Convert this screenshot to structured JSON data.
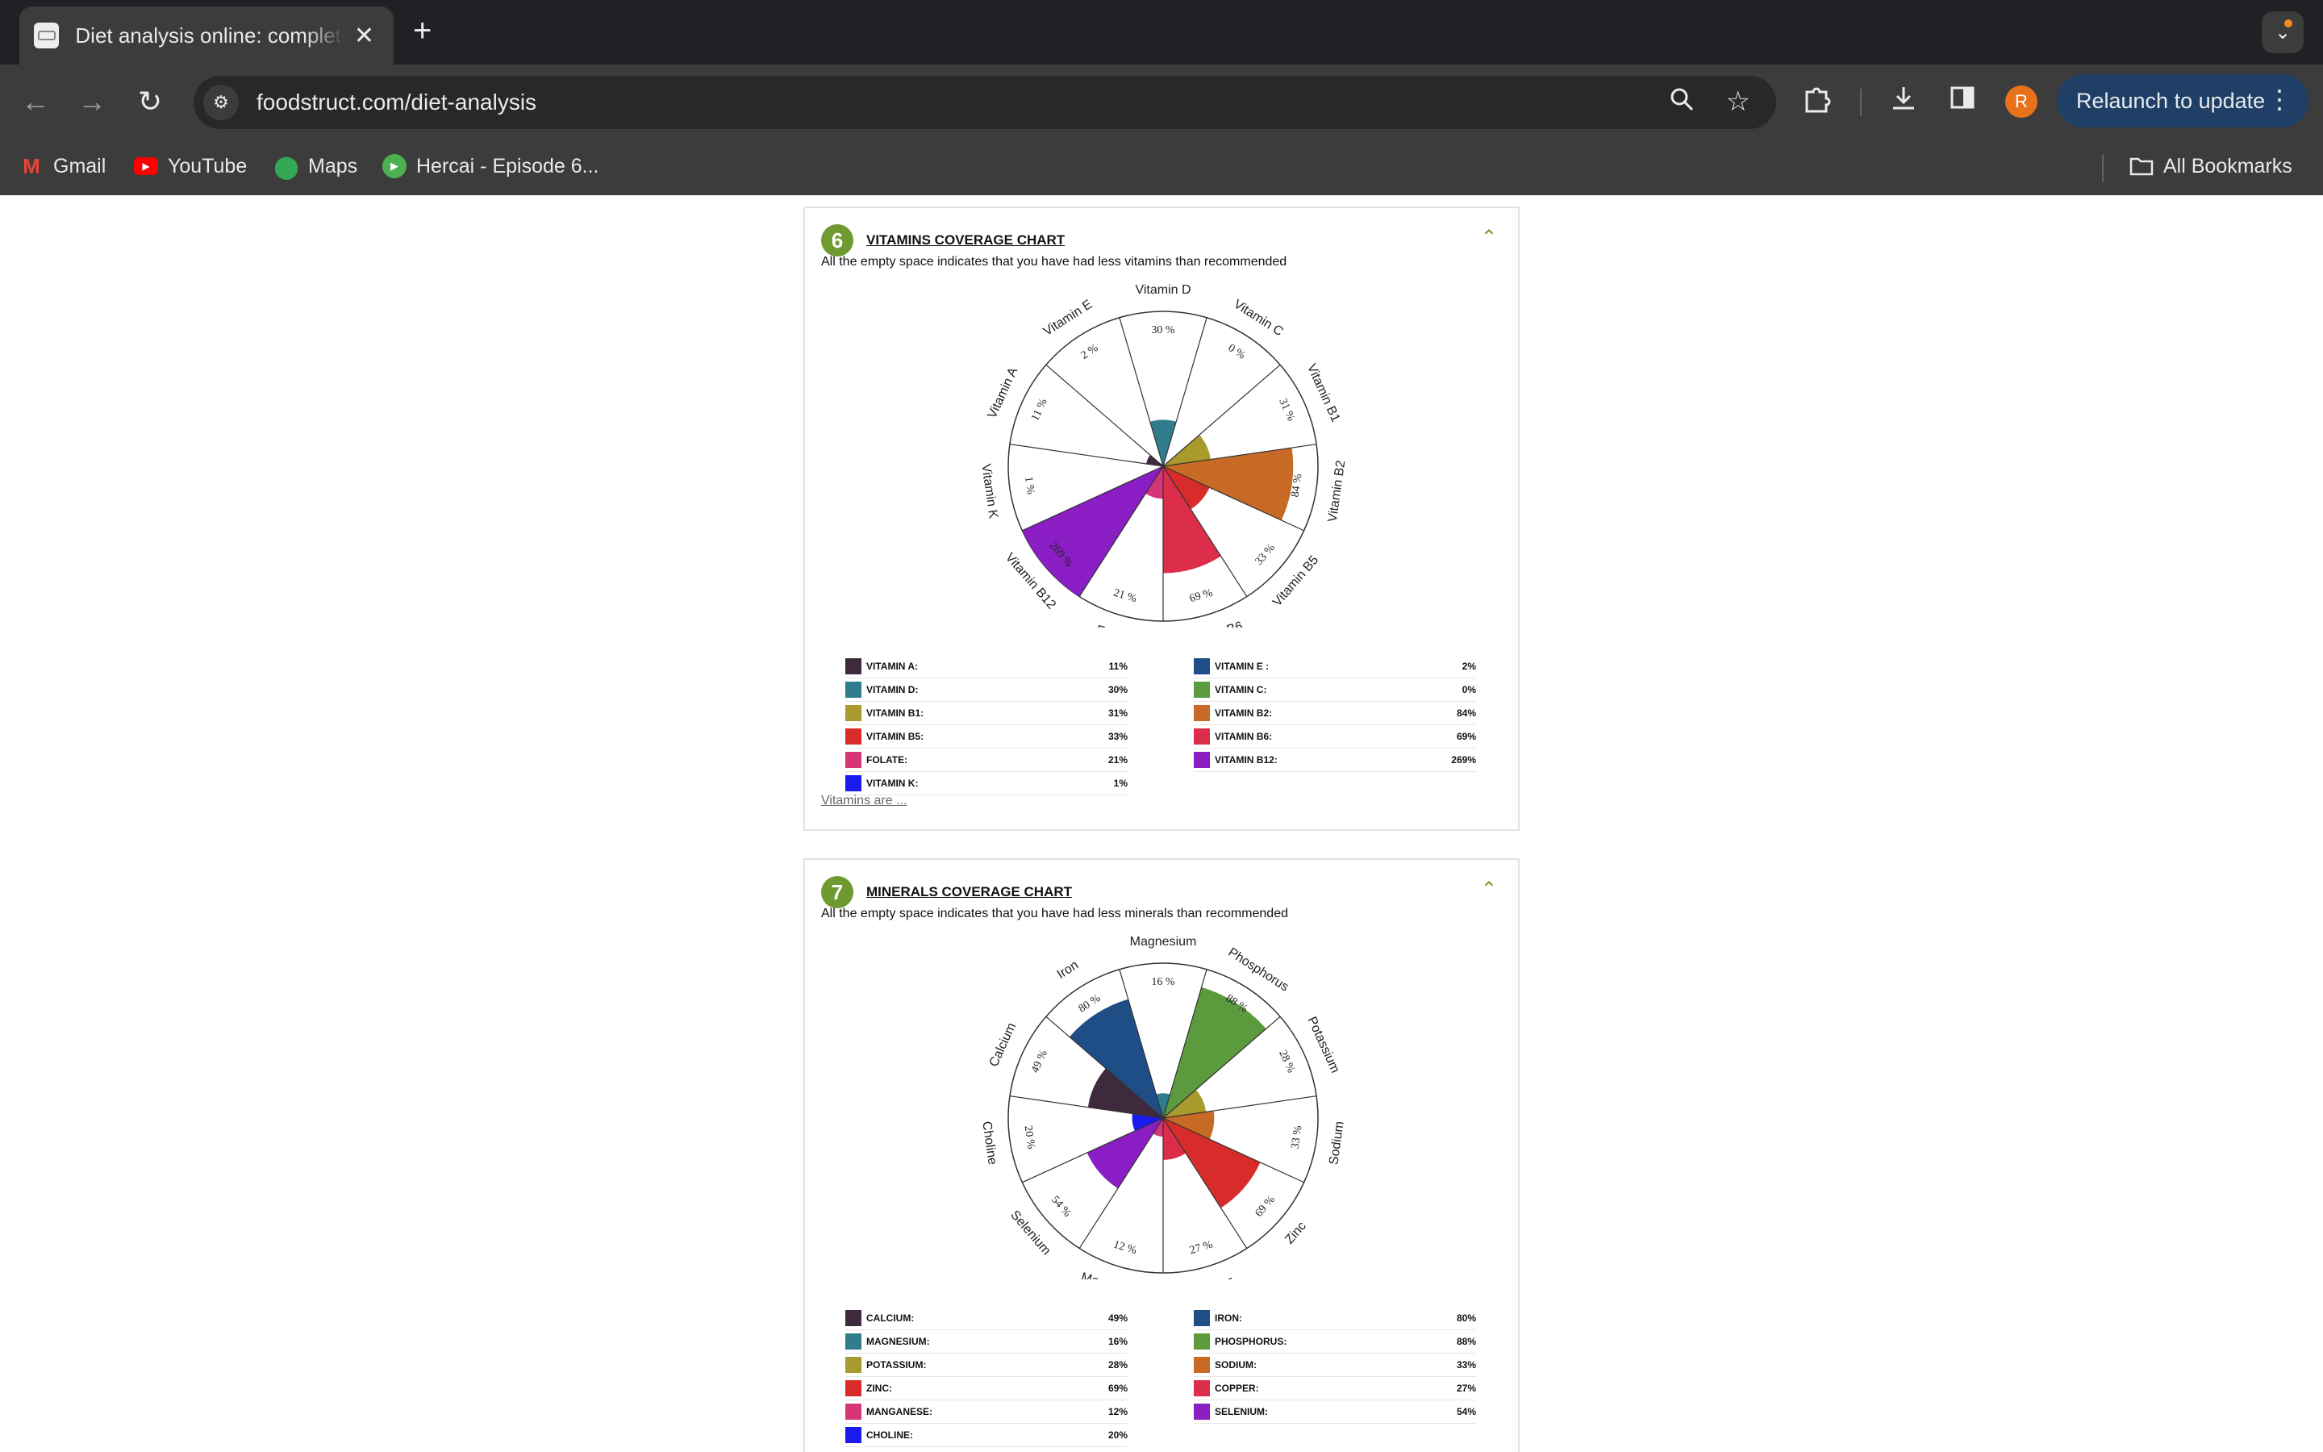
{
  "browser": {
    "tab_title": "Diet analysis online: complete",
    "url": "foodstruct.com/diet-analysis",
    "relaunch_label": "Relaunch to update",
    "avatar_letter": "R",
    "bookmarks": [
      {
        "label": "Gmail",
        "icon": "gmail-icon",
        "color": "#ea4335"
      },
      {
        "label": "YouTube",
        "icon": "youtube-icon",
        "color": "#ff0000"
      },
      {
        "label": "Maps",
        "icon": "maps-icon",
        "color": "#34a853"
      },
      {
        "label": "Hercai - Episode 6...",
        "icon": "play-icon",
        "color": "#4caf50"
      }
    ],
    "all_bookmarks_label": "All Bookmarks"
  },
  "vitamins": {
    "number": "6",
    "title": "VITAMINS COVERAGE CHART",
    "subtitle": "All the empty space indicates that you have had less vitamins than recommended",
    "link": "Vitamins are ...",
    "legend_left": [
      {
        "name": "VITAMIN A:",
        "value": "11%",
        "color": "#3f2a3d"
      },
      {
        "name": "VITAMIN D:",
        "value": "30%",
        "color": "#2f7c8c"
      },
      {
        "name": "VITAMIN B1:",
        "value": "31%",
        "color": "#a89a2c"
      },
      {
        "name": "VITAMIN B5:",
        "value": "33%",
        "color": "#d82c2a"
      },
      {
        "name": "FOLATE:",
        "value": "21%",
        "color": "#d6357a"
      },
      {
        "name": "VITAMIN K:",
        "value": "1%",
        "color": "#1a1aef"
      }
    ],
    "legend_right": [
      {
        "name": "VITAMIN E :",
        "value": "2%",
        "color": "#1f4e86"
      },
      {
        "name": "VITAMIN C:",
        "value": "0%",
        "color": "#5c9a3e"
      },
      {
        "name": "VITAMIN B2:",
        "value": "84%",
        "color": "#c66a25"
      },
      {
        "name": "VITAMIN B6:",
        "value": "69%",
        "color": "#dc2d4b"
      },
      {
        "name": "VITAMIN B12:",
        "value": "269%",
        "color": "#8a1dc4"
      }
    ]
  },
  "minerals": {
    "number": "7",
    "title": "MINERALS COVERAGE CHART",
    "subtitle": "All the empty space indicates that you have had less minerals than recommended",
    "legend_left": [
      {
        "name": "CALCIUM:",
        "value": "49%",
        "color": "#3f2a3d"
      },
      {
        "name": "MAGNESIUM:",
        "value": "16%",
        "color": "#2f7c8c"
      },
      {
        "name": "POTASSIUM:",
        "value": "28%",
        "color": "#a89a2c"
      },
      {
        "name": "ZINC:",
        "value": "69%",
        "color": "#d82c2a"
      },
      {
        "name": "MANGANESE:",
        "value": "12%",
        "color": "#d6357a"
      },
      {
        "name": "CHOLINE:",
        "value": "20%",
        "color": "#1a1aef"
      }
    ],
    "legend_right": [
      {
        "name": "IRON:",
        "value": "80%",
        "color": "#1f4e86"
      },
      {
        "name": "PHOSPHORUS:",
        "value": "88%",
        "color": "#5c9a3e"
      },
      {
        "name": "SODIUM:",
        "value": "33%",
        "color": "#c66a25"
      },
      {
        "name": "COPPER:",
        "value": "27%",
        "color": "#dc2d4b"
      },
      {
        "name": "SELENIUM:",
        "value": "54%",
        "color": "#8a1dc4"
      }
    ]
  },
  "chart_data": [
    {
      "type": "polar-area",
      "title": "VITAMINS COVERAGE CHART",
      "categories": [
        "Vitamin D",
        "Vitamin C",
        "Vitamin B1",
        "Vitamin B2",
        "Vitamin B5",
        "Vitamin B6",
        "Folate",
        "Vitamin B12",
        "Vitamin K",
        "Vitamin A",
        "Vitamin E"
      ],
      "values": [
        30,
        0,
        31,
        84,
        33,
        69,
        21,
        269,
        1,
        11,
        2
      ],
      "colors": [
        "#2f7c8c",
        "#5c9a3e",
        "#a89a2c",
        "#c66a25",
        "#d82c2a",
        "#dc2d4b",
        "#d6357a",
        "#8a1dc4",
        "#1a1aef",
        "#3f2a3d",
        "#1f4e86"
      ],
      "max": 100
    },
    {
      "type": "polar-area",
      "title": "MINERALS COVERAGE CHART",
      "categories": [
        "Magnesium",
        "Phosphorus",
        "Potassium",
        "Sodium",
        "Zinc",
        "Copper",
        "Manganese",
        "Selenium",
        "Choline",
        "Calcium",
        "Iron"
      ],
      "values": [
        16,
        88,
        28,
        33,
        69,
        27,
        12,
        54,
        20,
        49,
        80
      ],
      "colors": [
        "#2f7c8c",
        "#5c9a3e",
        "#a89a2c",
        "#c66a25",
        "#d82c2a",
        "#dc2d4b",
        "#d6357a",
        "#8a1dc4",
        "#1a1aef",
        "#3f2a3d",
        "#1f4e86"
      ],
      "max": 100
    }
  ]
}
